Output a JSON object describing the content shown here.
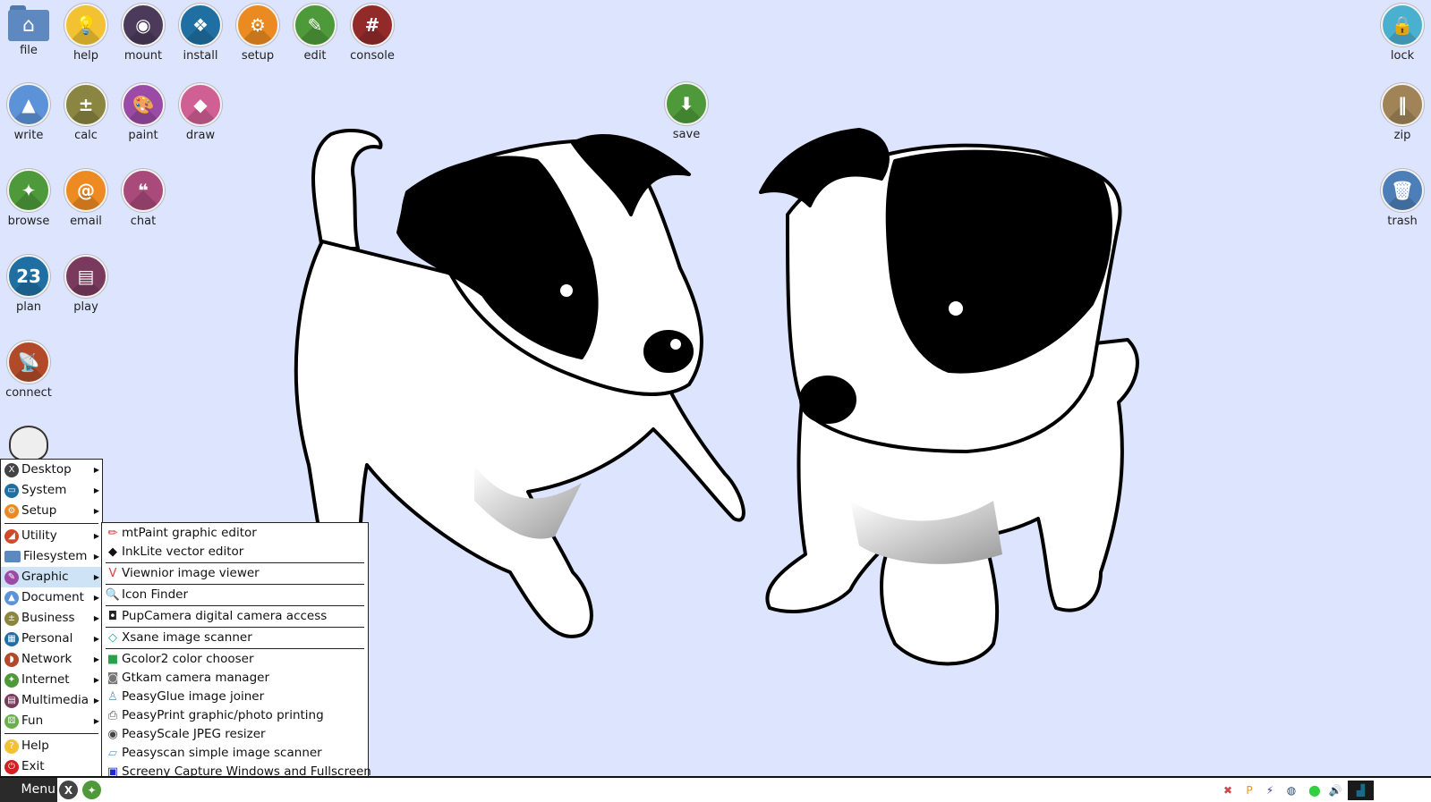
{
  "desktop": {
    "background_color": "#dde4fd",
    "icons_left": [
      {
        "name": "file",
        "label": "file",
        "color": "#5d89c0",
        "glyph": "⌂"
      },
      {
        "name": "help",
        "label": "help",
        "color": "#f2c233",
        "glyph": "💡"
      },
      {
        "name": "mount",
        "label": "mount",
        "color": "#4b3a5a",
        "glyph": "◉"
      },
      {
        "name": "install",
        "label": "install",
        "color": "#1f6fa3",
        "glyph": "❖"
      },
      {
        "name": "setup",
        "label": "setup",
        "color": "#ec8a22",
        "glyph": "⚙"
      },
      {
        "name": "edit",
        "label": "edit",
        "color": "#4e9a3a",
        "glyph": "✎"
      },
      {
        "name": "console",
        "label": "console",
        "color": "#922a2a",
        "glyph": "#"
      },
      {
        "name": "write",
        "label": "write",
        "color": "#5c93d8",
        "glyph": "▲"
      },
      {
        "name": "calc",
        "label": "calc",
        "color": "#8a8540",
        "glyph": "±"
      },
      {
        "name": "paint",
        "label": "paint",
        "color": "#9b4aa5",
        "glyph": "🎨"
      },
      {
        "name": "draw",
        "label": "draw",
        "color": "#d05f93",
        "glyph": "◆"
      },
      {
        "name": "browse",
        "label": "browse",
        "color": "#4e9a3a",
        "glyph": "✦"
      },
      {
        "name": "email",
        "label": "email",
        "color": "#ee8a22",
        "glyph": "@"
      },
      {
        "name": "chat",
        "label": "chat",
        "color": "#a94a7a",
        "glyph": "❝"
      },
      {
        "name": "plan",
        "label": "plan",
        "color": "#1f6fa3",
        "glyph": "23"
      },
      {
        "name": "play",
        "label": "play",
        "color": "#7a3a5e",
        "glyph": "▤"
      },
      {
        "name": "connect",
        "label": "connect",
        "color": "#b24a2a",
        "glyph": "📡"
      }
    ],
    "icons_right": [
      {
        "name": "lock",
        "label": "lock",
        "color": "#4ab0d0",
        "glyph": "🔒"
      },
      {
        "name": "zip",
        "label": "zip",
        "color": "#a08458",
        "glyph": "‖"
      },
      {
        "name": "trash",
        "label": "trash",
        "color": "#4c7fb8",
        "glyph": "🗑"
      }
    ],
    "icon_save": {
      "name": "save",
      "label": "save",
      "color": "#4e9a3a",
      "glyph": "⬇"
    }
  },
  "main_menu": {
    "items": [
      {
        "label": "Desktop",
        "icon": "x-icon",
        "color": "#444",
        "glyph": "X",
        "submenu": true
      },
      {
        "label": "System",
        "icon": "monitor-icon",
        "color": "#1f6fa3",
        "glyph": "▭",
        "submenu": true
      },
      {
        "label": "Setup",
        "icon": "gear-icon",
        "color": "#ec8a22",
        "glyph": "⚙",
        "submenu": true
      },
      {
        "separator": true
      },
      {
        "label": "Utility",
        "icon": "utility-icon",
        "color": "#d04a2a",
        "glyph": "◢",
        "submenu": true
      },
      {
        "label": "Filesystem",
        "icon": "folder-icon",
        "color": "#5d89c0",
        "glyph": "",
        "submenu": true
      },
      {
        "label": "Graphic",
        "icon": "palette-icon",
        "color": "#9b4aa5",
        "glyph": "✎",
        "submenu": true,
        "active": true
      },
      {
        "label": "Document",
        "icon": "document-icon",
        "color": "#5c93d8",
        "glyph": "▲",
        "submenu": true
      },
      {
        "label": "Business",
        "icon": "calculator-icon",
        "color": "#8a8540",
        "glyph": "±",
        "submenu": true
      },
      {
        "label": "Personal",
        "icon": "calendar-icon",
        "color": "#1f6fa3",
        "glyph": "▦",
        "submenu": true
      },
      {
        "label": "Network",
        "icon": "satellite-icon",
        "color": "#b24a2a",
        "glyph": "◗",
        "submenu": true
      },
      {
        "label": "Internet",
        "icon": "compass-icon",
        "color": "#4e9a3a",
        "glyph": "✦",
        "submenu": true
      },
      {
        "label": "Multimedia",
        "icon": "clapper-icon",
        "color": "#7a3a5e",
        "glyph": "▤",
        "submenu": true
      },
      {
        "label": "Fun",
        "icon": "dice-icon",
        "color": "#6ab04a",
        "glyph": "⚄",
        "submenu": true
      },
      {
        "separator": true
      },
      {
        "label": "Help",
        "icon": "lightbulb-icon",
        "color": "#f2c233",
        "glyph": "?",
        "submenu": false
      },
      {
        "label": "Exit",
        "icon": "power-icon",
        "color": "#d02020",
        "glyph": "⏻",
        "submenu": false
      }
    ]
  },
  "graphic_submenu": {
    "items": [
      {
        "label": "mtPaint graphic editor",
        "icon": "pencils-icon",
        "color": "#d03030",
        "glyph": "✏"
      },
      {
        "label": "InkLite vector editor",
        "icon": "inkscape-icon",
        "color": "#111111",
        "glyph": "◆"
      },
      {
        "separator": true
      },
      {
        "label": "Viewnior image viewer",
        "icon": "viewnior-icon",
        "color": "#e04040",
        "glyph": "V"
      },
      {
        "separator": true
      },
      {
        "label": "Icon Finder",
        "icon": "magnifier-icon",
        "color": "#5a4a9a",
        "glyph": "🔍"
      },
      {
        "separator": true
      },
      {
        "label": "PupCamera digital camera access",
        "icon": "camera-icon",
        "color": "#222222",
        "glyph": "◘"
      },
      {
        "separator": true
      },
      {
        "label": "Xsane image scanner",
        "icon": "scanner-icon",
        "color": "#2aa0a0",
        "glyph": "◇"
      },
      {
        "separator": true
      },
      {
        "label": "Gcolor2 color chooser",
        "icon": "color-cube-icon",
        "color": "#2aa04a",
        "glyph": "■"
      },
      {
        "label": "Gtkam camera manager",
        "icon": "gtkam-icon",
        "color": "#777777",
        "glyph": "◙"
      },
      {
        "label": "PeasyGlue image joiner",
        "icon": "glue-icon",
        "color": "#6aa0c0",
        "glyph": "♙"
      },
      {
        "label": "PeasyPrint graphic/photo printing",
        "icon": "printer-icon",
        "color": "#555555",
        "glyph": "⎙"
      },
      {
        "label": "PeasyScale JPEG resizer",
        "icon": "photo-camera-icon",
        "color": "#444444",
        "glyph": "◉"
      },
      {
        "label": "Peasyscan simple image scanner",
        "icon": "flatbed-scanner-icon",
        "color": "#7aa0c8",
        "glyph": "▱"
      },
      {
        "label": "Screeny Capture Windows and Fullscreen",
        "icon": "screen-icon",
        "color": "#1a2ad0",
        "glyph": "▣"
      }
    ]
  },
  "taskbar": {
    "menu_label": "Menu",
    "quicklaunch": [
      {
        "name": "desktop-x-icon",
        "color": "#444444",
        "glyph": "X"
      },
      {
        "name": "browser-icon",
        "color": "#4e9a3a",
        "glyph": "✦"
      }
    ],
    "tray": [
      {
        "name": "firewall-shield-icon",
        "color": "#c84a4a",
        "glyph": "✖"
      },
      {
        "name": "clipboard-p-icon",
        "color": "#e89a20",
        "glyph": "P"
      },
      {
        "name": "power-battery-icon",
        "color": "#3a3a9a",
        "glyph": "⚡"
      },
      {
        "name": "network-icon",
        "color": "#2a4a6a",
        "glyph": "◍"
      },
      {
        "name": "drive-icon",
        "color": "#30d040",
        "glyph": "⬤"
      },
      {
        "name": "volume-icon",
        "color": "#333333",
        "glyph": "🔊"
      },
      {
        "name": "cpu-monitor-icon",
        "color": "#1a5a7a",
        "glyph": "▟"
      }
    ]
  }
}
